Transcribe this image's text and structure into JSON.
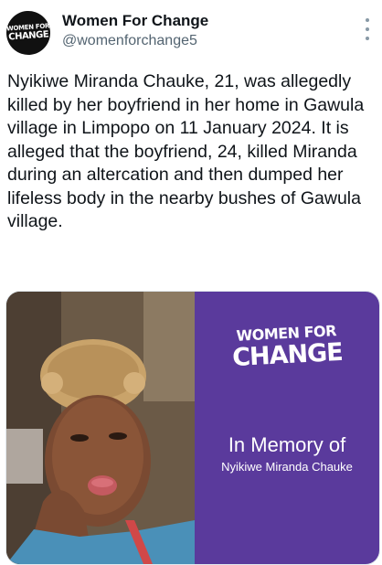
{
  "account": {
    "display_name": "Women For Change",
    "handle": "@womenforchange5",
    "avatar_text_line1": "WOMEN FOR",
    "avatar_text_line2": "CHANGE",
    "more_icon": "more-options-icon"
  },
  "tweet": {
    "text": "Nyikiwe Miranda Chauke, 21, was allegedly killed by her boyfriend in her home in Gawula village in Limpopo on 11 January 2024. It is alleged that the boyfriend, 24, killed Miranda during an altercation and then dumped her lifeless body in the nearby bushes of Gawula village."
  },
  "media": {
    "brand_line1": "WOMEN FOR",
    "brand_line2": "CHANGE",
    "memorial_title": "In Memory of",
    "memorial_name": "Nyikiwe Miranda Chauke",
    "panel_color": "#5a3a9c"
  }
}
